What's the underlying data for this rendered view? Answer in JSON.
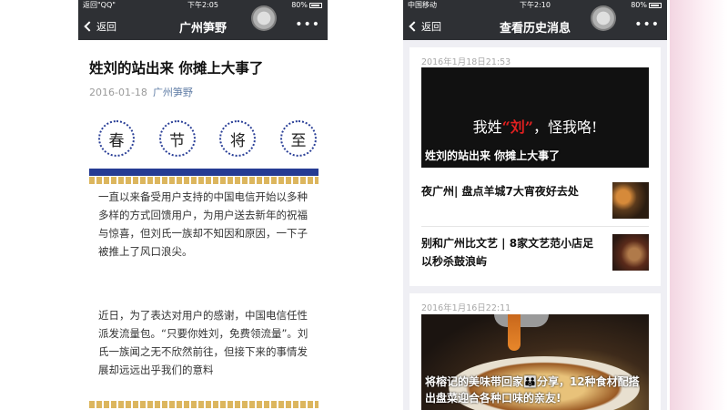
{
  "left": {
    "status": {
      "carrier": "返回\"QQ\"",
      "time": "下午2:05",
      "battery": "80%"
    },
    "nav": {
      "back_label": "返回",
      "title": "广州笋野",
      "more": "•••"
    },
    "article": {
      "title": "姓刘的站出来 你摊上大事了",
      "date": "2016-01-18",
      "author": "广州笋野",
      "seal_chars": [
        "春",
        "节",
        "将",
        "至"
      ],
      "paragraph_1": "一直以来备受用户支持的中国电信开始以多种多样的方式回馈用户，为用户送去新年的祝福与惊喜，但刘氏一族却不知因和原因，一下子被推上了风口浪尖。",
      "paragraph_2": "近日，为了表达对用户的感谢，中国电信任性派发流量包。“只要你姓刘，免费领流量”。刘氏一族闻之无不欣然前往，但接下来的事情发展却远远出乎我们的意料"
    }
  },
  "right": {
    "status": {
      "carrier": "中国移动",
      "time": "下午2:10",
      "battery": "80%"
    },
    "nav": {
      "back_label": "返回",
      "title": "查看历史消息",
      "more": "•••"
    },
    "group_1": {
      "date": "2016年1月18日21:53",
      "cover_text_pre": "我姓",
      "cover_text_name": "“刘”",
      "cover_text_post": "，怪我咯!",
      "cover_caption": "姓刘的站出来 你摊上大事了",
      "items": [
        {
          "title": "夜广州| 盘点羊城7大宵夜好去处"
        },
        {
          "title": "别和广州比文艺 | 8家文艺范小店足以秒杀鼓浪屿"
        }
      ]
    },
    "group_2": {
      "date": "2016年1月16日22:11",
      "cover_caption": "将榕记的美味带回家👪分享，12种食材配搭出盘菜迎合各种口味的亲友!"
    }
  }
}
